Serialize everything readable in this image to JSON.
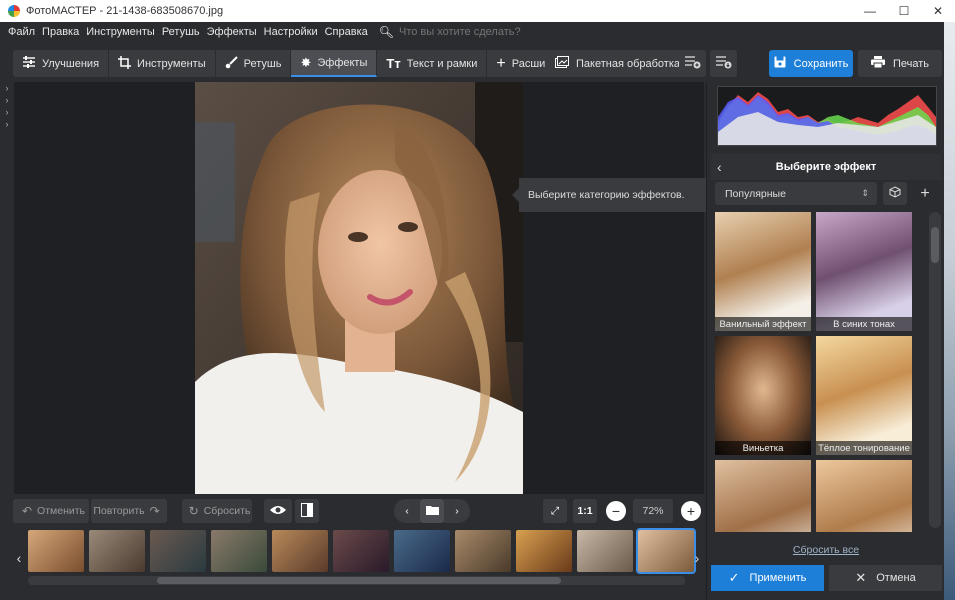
{
  "window": {
    "title": "ФотоМАСТЕР - 21-1438-683508670.jpg",
    "minimize": "—",
    "maximize": "☐",
    "close": "✕"
  },
  "menu": {
    "items": [
      "Файл",
      "Правка",
      "Инструменты",
      "Ретушь",
      "Эффекты",
      "Настройки",
      "Справка"
    ],
    "search_placeholder": "Что вы хотите сделать?"
  },
  "toolbar": {
    "tabs": [
      {
        "label": "Улучшения",
        "icon": "sliders-icon"
      },
      {
        "label": "Инструменты",
        "icon": "crop-icon"
      },
      {
        "label": "Ретушь",
        "icon": "brush-icon"
      },
      {
        "label": "Эффекты",
        "icon": "sparkle-icon"
      },
      {
        "label": "Текст и рамки",
        "icon": "text-icon"
      },
      {
        "label": "Расширения",
        "icon": "plus-icon"
      }
    ],
    "active_tab": "Эффекты",
    "batch_label": "Пакетная обработка",
    "save_label": "Сохранить",
    "print_label": "Печать"
  },
  "canvas": {
    "hint": "Выберите категорию эффектов."
  },
  "bottom": {
    "undo_label": "Отменить",
    "redo_label": "Повторить",
    "reset_label": "Сбросить",
    "one_to_one": "1:1",
    "zoom": "72%"
  },
  "filmstrip": {
    "thumbnail_count": 11,
    "selected_index": 10
  },
  "panel": {
    "title": "Выберите эффект",
    "category": "Популярные",
    "effects": [
      {
        "label": "Ванильный эффект"
      },
      {
        "label": "В синих тонах"
      },
      {
        "label": "Виньетка"
      },
      {
        "label": "Тёплое тонирование"
      },
      {
        "label": ""
      },
      {
        "label": ""
      }
    ],
    "reset_all": "Сбросить все",
    "apply_label": "Применить",
    "cancel_label": "Отмена"
  },
  "colors": {
    "accent": "#1e7fd8",
    "panel_bg": "#2b2c2f",
    "canvas_bg": "#1f2023"
  }
}
